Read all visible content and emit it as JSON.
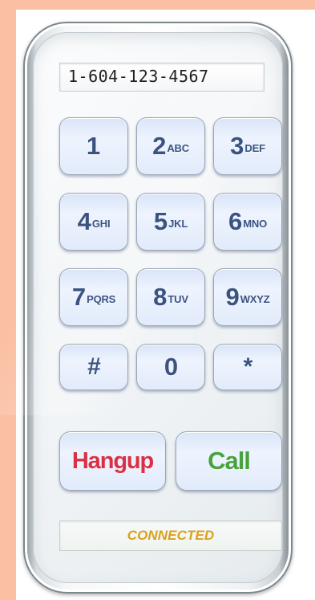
{
  "phone": {
    "display_number": "1-604-123-4567",
    "keys": [
      {
        "digit": "1",
        "letters": ""
      },
      {
        "digit": "2",
        "letters": "ABC"
      },
      {
        "digit": "3",
        "letters": "DEF"
      },
      {
        "digit": "4",
        "letters": "GHI"
      },
      {
        "digit": "5",
        "letters": "JKL"
      },
      {
        "digit": "6",
        "letters": "MNO"
      },
      {
        "digit": "7",
        "letters": "PQRS"
      },
      {
        "digit": "8",
        "letters": "TUV"
      },
      {
        "digit": "9",
        "letters": "WXYZ"
      },
      {
        "digit": "#",
        "letters": ""
      },
      {
        "digit": "0",
        "letters": ""
      },
      {
        "digit": "*",
        "letters": ""
      }
    ],
    "hangup_label": "Hangup",
    "call_label": "Call",
    "status": "CONNECTED"
  },
  "colors": {
    "frame_background": "#fbc0a4",
    "key_text": "#3a5381",
    "hangup_text": "#da3046",
    "call_text": "#48a33e",
    "status_text": "#d9a21b"
  }
}
